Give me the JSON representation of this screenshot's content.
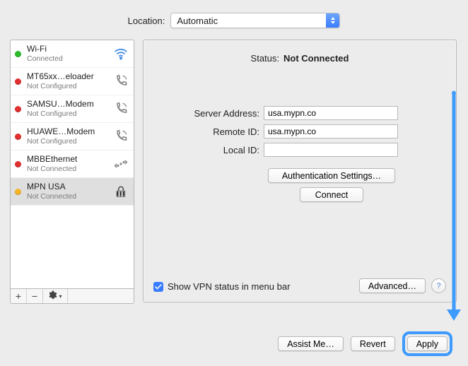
{
  "location": {
    "label": "Location:",
    "selected": "Automatic"
  },
  "sidebar": {
    "items": [
      {
        "name": "Wi-Fi",
        "status": "Connected",
        "dot": "green",
        "icon": "wifi"
      },
      {
        "name": "MT65xx…eloader",
        "status": "Not Configured",
        "dot": "red",
        "icon": "phone"
      },
      {
        "name": "SAMSU…Modem",
        "status": "Not Configured",
        "dot": "red",
        "icon": "phone"
      },
      {
        "name": "HUAWE…Modem",
        "status": "Not Configured",
        "dot": "red",
        "icon": "phone"
      },
      {
        "name": "MBBEthernet",
        "status": "Not Connected",
        "dot": "red",
        "icon": "ethernet"
      },
      {
        "name": "MPN USA",
        "status": "Not Connected",
        "dot": "yellow",
        "icon": "lock"
      }
    ],
    "selected_index": 5,
    "footer": {
      "add": "+",
      "remove": "−",
      "gear": "gear"
    }
  },
  "main": {
    "status_label": "Status:",
    "status_value": "Not Connected",
    "fields": {
      "server_address_label": "Server Address:",
      "server_address_value": "usa.mypn.co",
      "remote_id_label": "Remote ID:",
      "remote_id_value": "usa.mypn.co",
      "local_id_label": "Local ID:",
      "local_id_value": ""
    },
    "auth_button": "Authentication Settings…",
    "connect_button": "Connect",
    "show_vpn_label": "Show VPN status in menu bar",
    "show_vpn_checked": true,
    "advanced_button": "Advanced…",
    "help": "?"
  },
  "window_buttons": {
    "assist": "Assist Me…",
    "revert": "Revert",
    "apply": "Apply"
  }
}
